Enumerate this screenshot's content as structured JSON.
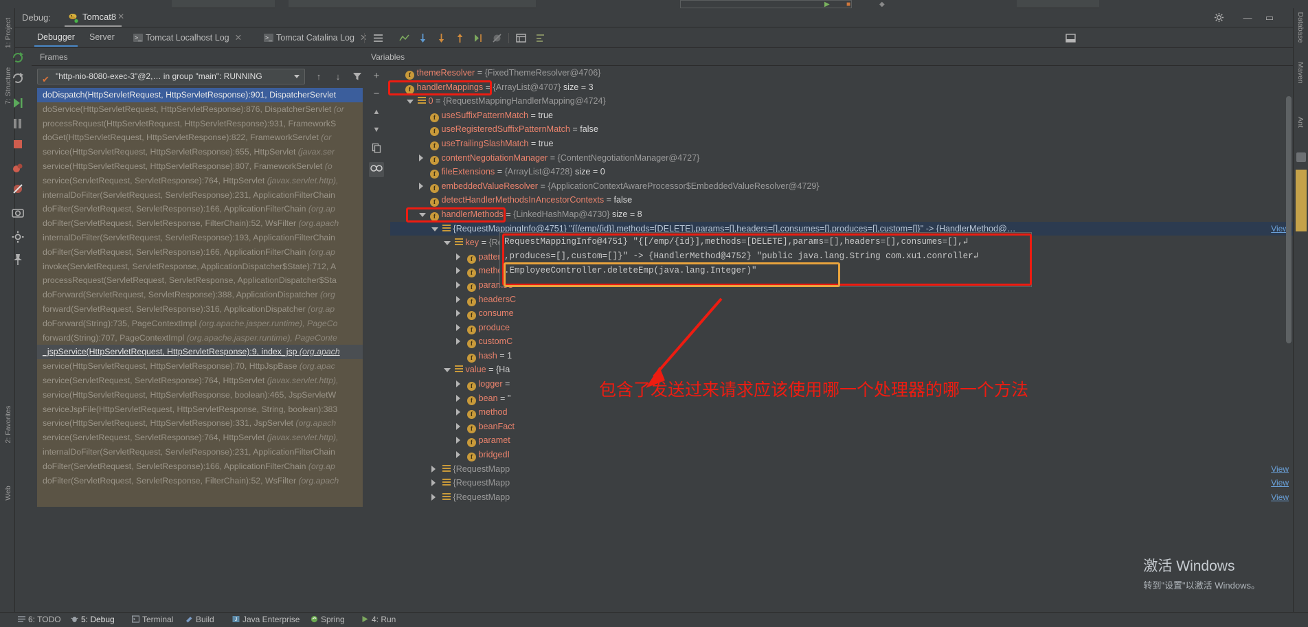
{
  "window": {
    "debug_label": "Debug:",
    "run_config_tab": "Tomcat8",
    "gear_icon": "gear-icon",
    "minimize_icon": "minimize-icon",
    "maximize_icon": "maximize-icon",
    "close_icon": "close-icon"
  },
  "left_rail": {
    "items": [
      {
        "label": "1: Project",
        "name": "tool-window-project"
      },
      {
        "label": "7: Structure",
        "name": "tool-window-structure"
      },
      {
        "label": "2: Favorites",
        "name": "tool-window-favorites"
      },
      {
        "label": "Web",
        "name": "tool-window-web"
      }
    ]
  },
  "right_rail": {
    "items": [
      {
        "label": "Database",
        "name": "tool-window-database"
      },
      {
        "label": "Maven",
        "name": "tool-window-maven"
      },
      {
        "label": "Ant",
        "name": "tool-window-ant"
      }
    ]
  },
  "debug_tabs": [
    {
      "label": "Debugger",
      "active": true,
      "closable": false,
      "icon": ""
    },
    {
      "label": "Server",
      "active": false,
      "closable": false,
      "icon": ""
    },
    {
      "label": "Tomcat Localhost Log",
      "active": false,
      "closable": true,
      "icon": "console-icon"
    },
    {
      "label": "Tomcat Catalina Log",
      "active": false,
      "closable": true,
      "icon": "console-icon"
    }
  ],
  "toolbar_icons": [
    "layout-icon",
    "sort-icon",
    "step-over-icon",
    "step-into-icon",
    "step-out-icon",
    "run-to-cursor-icon",
    "evaluate-icon",
    "mute-breakpoints-icon",
    "settings-icon"
  ],
  "run_controls": [
    "rerun-icon",
    "update-icon",
    "resume-icon",
    "pause-icon",
    "stop-icon",
    "view-breakpoints-icon",
    "mute-breakpoints-icon",
    "camera-icon",
    "settings-icon",
    "pin-icon"
  ],
  "frames": {
    "title": "Frames",
    "thread_selector": {
      "value": "\"http-nio-8080-exec-3\"@2,… in group \"main\": RUNNING",
      "status_icon": "checkmark-icon"
    },
    "toolbar_icons": [
      "arrow-up-icon",
      "arrow-down-icon",
      "filter-icon"
    ],
    "rows": [
      {
        "text": "doDispatch(HttpServletRequest, HttpServletResponse):901, DispatcherServlet",
        "pkg": "",
        "state": "selected"
      },
      {
        "text": "doService(HttpServletRequest, HttpServletResponse):876, DispatcherServlet",
        "pkg": " (or",
        "state": ""
      },
      {
        "text": "processRequest(HttpServletRequest, HttpServletResponse):931, FrameworkS",
        "pkg": "",
        "state": ""
      },
      {
        "text": "doGet(HttpServletRequest, HttpServletResponse):822, FrameworkServlet",
        "pkg": " (or",
        "state": ""
      },
      {
        "text": "service(HttpServletRequest, HttpServletResponse):655, HttpServlet",
        "pkg": " (javax.ser",
        "state": ""
      },
      {
        "text": "service(HttpServletRequest, HttpServletResponse):807, FrameworkServlet",
        "pkg": " (o",
        "state": ""
      },
      {
        "text": "service(ServletRequest, ServletResponse):764, HttpServlet",
        "pkg": " (javax.servlet.http),",
        "state": ""
      },
      {
        "text": "internalDoFilter(ServletRequest, ServletResponse):231, ApplicationFilterChain",
        "pkg": "",
        "state": ""
      },
      {
        "text": "doFilter(ServletRequest, ServletResponse):166, ApplicationFilterChain",
        "pkg": " (org.ap",
        "state": ""
      },
      {
        "text": "doFilter(ServletRequest, ServletResponse, FilterChain):52, WsFilter",
        "pkg": " (org.apach",
        "state": ""
      },
      {
        "text": "internalDoFilter(ServletRequest, ServletResponse):193, ApplicationFilterChain",
        "pkg": "",
        "state": ""
      },
      {
        "text": "doFilter(ServletRequest, ServletResponse):166, ApplicationFilterChain",
        "pkg": " (org.ap",
        "state": ""
      },
      {
        "text": "invoke(ServletRequest, ServletResponse, ApplicationDispatcher$State):712, A",
        "pkg": "",
        "state": ""
      },
      {
        "text": "processRequest(ServletRequest, ServletResponse, ApplicationDispatcher$Sta",
        "pkg": "",
        "state": ""
      },
      {
        "text": "doForward(ServletRequest, ServletResponse):388, ApplicationDispatcher",
        "pkg": " (org",
        "state": ""
      },
      {
        "text": "forward(ServletRequest, ServletResponse):316, ApplicationDispatcher",
        "pkg": " (org.ap",
        "state": ""
      },
      {
        "text": "doForward(String):735, PageContextImpl",
        "pkg": " (org.apache.jasper.runtime), PageCo",
        "state": ""
      },
      {
        "text": "forward(String):707, PageContextImpl",
        "pkg": " (org.apache.jasper.runtime), PageConte",
        "state": ""
      },
      {
        "text": "_jspService(HttpServletRequest, HttpServletResponse):9, index_jsp",
        "pkg": " (org.apach",
        "state": "current"
      },
      {
        "text": "service(HttpServletRequest, HttpServletResponse):70, HttpJspBase",
        "pkg": " (org.apac",
        "state": ""
      },
      {
        "text": "service(ServletRequest, ServletResponse):764, HttpServlet",
        "pkg": " (javax.servlet.http),",
        "state": ""
      },
      {
        "text": "service(HttpServletRequest, HttpServletResponse, boolean):465, JspServletW",
        "pkg": "",
        "state": ""
      },
      {
        "text": "serviceJspFile(HttpServletRequest, HttpServletResponse, String, boolean):383",
        "pkg": "",
        "state": ""
      },
      {
        "text": "service(HttpServletRequest, HttpServletResponse):331, JspServlet",
        "pkg": " (org.apach",
        "state": ""
      },
      {
        "text": "service(ServletRequest, ServletResponse):764, HttpServlet",
        "pkg": " (javax.servlet.http),",
        "state": ""
      },
      {
        "text": "internalDoFilter(ServletRequest, ServletResponse):231, ApplicationFilterChain",
        "pkg": "",
        "state": ""
      },
      {
        "text": "doFilter(ServletRequest, ServletResponse):166, ApplicationFilterChain",
        "pkg": " (org.ap",
        "state": ""
      },
      {
        "text": "doFilter(ServletRequest, ServletResponse, FilterChain):52, WsFilter",
        "pkg": " (org.apach",
        "state": ""
      }
    ]
  },
  "variables": {
    "title": "Variables",
    "side_icons": [
      "add-icon",
      "remove-icon",
      "up-icon",
      "down-icon",
      "copy-icon",
      "watches-icon"
    ],
    "view_link": "View",
    "rows": [
      {
        "indent": 0,
        "arrow": "none",
        "icon": "field-icon",
        "name": "themeResolver",
        "eq": " = ",
        "value": "{FixedThemeResolver@4706}",
        "size": ""
      },
      {
        "indent": 0,
        "arrow": "none",
        "icon": "field-icon",
        "name": "handlerMappings",
        "eq": " = ",
        "value": "{ArrayList@4707}",
        "size": "size = 3",
        "boxed": true
      },
      {
        "indent": 1,
        "arrow": "open",
        "icon": "list-icon",
        "name": "0",
        "eq": " = ",
        "value": "{RequestMappingHandlerMapping@4724}",
        "size": "",
        "is_index": true
      },
      {
        "indent": 2,
        "arrow": "none",
        "icon": "field-icon",
        "name": "useSuffixPatternMatch",
        "eq": " = ",
        "value": "",
        "bool": "true"
      },
      {
        "indent": 2,
        "arrow": "none",
        "icon": "field-icon",
        "name": "useRegisteredSuffixPatternMatch",
        "eq": " = ",
        "value": "",
        "bool": "false"
      },
      {
        "indent": 2,
        "arrow": "none",
        "icon": "field-icon",
        "name": "useTrailingSlashMatch",
        "eq": " = ",
        "value": "",
        "bool": "true"
      },
      {
        "indent": 2,
        "arrow": "closed",
        "icon": "field-icon",
        "name": "contentNegotiationManager",
        "eq": " = ",
        "value": "{ContentNegotiationManager@4727}",
        "size": ""
      },
      {
        "indent": 2,
        "arrow": "none",
        "icon": "field-icon",
        "name": "fileExtensions",
        "eq": " = ",
        "value": "{ArrayList@4728}",
        "size": "size = 0"
      },
      {
        "indent": 2,
        "arrow": "closed",
        "icon": "field-icon",
        "name": "embeddedValueResolver",
        "eq": " = ",
        "value": "{ApplicationContextAwareProcessor$EmbeddedValueResolver@4729}",
        "size": ""
      },
      {
        "indent": 2,
        "arrow": "none",
        "icon": "field-icon",
        "name": "detectHandlerMethodsInAncestorContexts",
        "eq": " = ",
        "value": "",
        "bool": "false"
      },
      {
        "indent": 2,
        "arrow": "open",
        "icon": "field-icon",
        "name": "handlerMethods",
        "eq": " = ",
        "value": "{LinkedHashMap@4730}",
        "size": "size = 8",
        "boxed": true
      },
      {
        "indent": 3,
        "arrow": "open",
        "icon": "list-icon",
        "name": "",
        "eq": "",
        "value": "{RequestMappingInfo@4751} \"{[/emp/{id}],methods=[DELETE],params=[],headers=[],consumes=[],produces=[],custom=[]}\" -> {HandlerMethod@…",
        "size": "",
        "selected": true,
        "has_view": true
      },
      {
        "indent": 4,
        "arrow": "open",
        "icon": "list-icon",
        "name": "key",
        "eq": " = ",
        "value": "{Requ",
        "size": ""
      },
      {
        "indent": 5,
        "arrow": "closed",
        "icon": "field-icon",
        "name": "patterns",
        "eq": "",
        "value": "",
        "size": ""
      },
      {
        "indent": 5,
        "arrow": "closed",
        "icon": "field-icon",
        "name": "methods",
        "eq": " =",
        "value": "",
        "size": ""
      },
      {
        "indent": 5,
        "arrow": "closed",
        "icon": "field-icon",
        "name": "paramsC",
        "eq": "",
        "value": "",
        "size": ""
      },
      {
        "indent": 5,
        "arrow": "closed",
        "icon": "field-icon",
        "name": "headersC",
        "eq": "",
        "value": "",
        "size": ""
      },
      {
        "indent": 5,
        "arrow": "closed",
        "icon": "field-icon",
        "name": "consume",
        "eq": "",
        "value": "",
        "size": ""
      },
      {
        "indent": 5,
        "arrow": "closed",
        "icon": "field-icon",
        "name": "produce",
        "eq": "",
        "value": "",
        "size": ""
      },
      {
        "indent": 5,
        "arrow": "closed",
        "icon": "field-icon",
        "name": "customC",
        "eq": "",
        "value": "",
        "size": ""
      },
      {
        "indent": 5,
        "arrow": "none",
        "icon": "field-icon",
        "name": "hash",
        "eq": " = 1",
        "value": "",
        "size": ""
      },
      {
        "indent": 4,
        "arrow": "open",
        "icon": "list-icon",
        "name": "value",
        "eq": " = {Ha",
        "value": "",
        "size": ""
      },
      {
        "indent": 5,
        "arrow": "closed",
        "icon": "field-icon",
        "name": "logger",
        "eq": " = ",
        "value": "",
        "size": ""
      },
      {
        "indent": 5,
        "arrow": "closed",
        "icon": "field-icon",
        "name": "bean",
        "eq": " = \"",
        "value": "",
        "size": ""
      },
      {
        "indent": 5,
        "arrow": "closed",
        "icon": "field-icon",
        "name": "method",
        "eq": "",
        "value": "",
        "size": ""
      },
      {
        "indent": 5,
        "arrow": "closed",
        "icon": "field-icon",
        "name": "beanFact",
        "eq": "",
        "value": "",
        "size": ""
      },
      {
        "indent": 5,
        "arrow": "closed",
        "icon": "field-icon",
        "name": "paramet",
        "eq": "",
        "value": "",
        "size": ""
      },
      {
        "indent": 5,
        "arrow": "closed",
        "icon": "field-icon",
        "name": "bridgedI",
        "eq": "",
        "value": "",
        "size": ""
      },
      {
        "indent": 3,
        "arrow": "closed",
        "icon": "list-icon",
        "name": "",
        "eq": "",
        "value": "{RequestMapp",
        "size": "",
        "has_view": true
      },
      {
        "indent": 3,
        "arrow": "closed",
        "icon": "list-icon",
        "name": "",
        "eq": "",
        "value": "{RequestMapp",
        "size": "",
        "has_view": true
      },
      {
        "indent": 3,
        "arrow": "closed",
        "icon": "list-icon",
        "name": "",
        "eq": "",
        "value": "{RequestMapp",
        "size": "",
        "has_view": true
      }
    ]
  },
  "tooltip": {
    "line1": "RequestMappingInfo@4751} \"{[/emp/{id}],methods=[DELETE],params=[],headers=[],consumes=[],↲",
    "line2": ",produces=[],custom=[]}\" -> {HandlerMethod@4752} \"public java.lang.String com.xu1.conroller↲",
    "line3": ".EmployeeController.deleteEmp(java.lang.Integer)\""
  },
  "annotation": {
    "note": "包含了发送过来请求应该使用哪一个处理器的哪一个方法",
    "note_color": "#ee1c11",
    "box_color": "#ee1c11",
    "inner_box_color": "#e8a33d"
  },
  "watermark": {
    "line1": "激活 Windows",
    "line2": "转到\"设置\"以激活 Windows。"
  },
  "statusbar": {
    "items": [
      {
        "label": "6: TODO",
        "icon": "todo-icon"
      },
      {
        "label": "5: Debug",
        "icon": "debug-icon"
      },
      {
        "label": "Terminal",
        "icon": "terminal-icon"
      },
      {
        "label": "Build",
        "icon": "build-icon"
      },
      {
        "label": "Java Enterprise",
        "icon": "java-enterprise-icon"
      },
      {
        "label": "Spring",
        "icon": "spring-icon"
      },
      {
        "label": "4: Run",
        "icon": "run-icon"
      }
    ]
  }
}
